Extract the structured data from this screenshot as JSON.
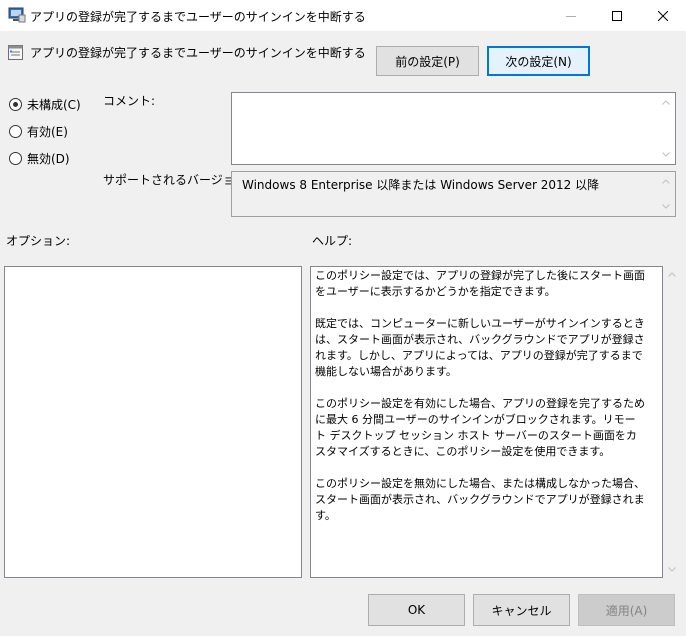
{
  "window": {
    "title": "アプリの登録が完了するまでユーザーのサインインを中断する",
    "controls": {
      "minimize_icon": "minimize-icon",
      "maximize_icon": "maximize-icon",
      "close_icon": "close-icon"
    }
  },
  "header": {
    "policy_name": "アプリの登録が完了するまでユーザーのサインインを中断する",
    "prev_label": "前の設定(P)",
    "next_label": "次の設定(N)"
  },
  "state": {
    "options": [
      {
        "label": "未構成(C)",
        "checked": true
      },
      {
        "label": "有効(E)",
        "checked": false
      },
      {
        "label": "無効(D)",
        "checked": false
      }
    ]
  },
  "comment": {
    "label": "コメント:",
    "value": ""
  },
  "supported": {
    "label": "サポートされるバージョン:",
    "value": "Windows 8 Enterprise 以降または Windows Server 2012 以降"
  },
  "options_label": "オプション:",
  "help": {
    "label": "ヘルプ:",
    "text": "このポリシー設定では、アプリの登録が完了した後にスタート画面をユーザーに表示するかどうかを指定できます。\n\n既定では、コンピューターに新しいユーザーがサインインするときは、スタート画面が表示され、バックグラウンドでアプリが登録されます。しかし、アプリによっては、アプリの登録が完了するまで機能しない場合があります。\n\nこのポリシー設定を有効にした場合、アプリの登録を完了するために最大 6 分間ユーザーのサインインがブロックされます。リモート デスクトップ セッション ホスト サーバーのスタート画面をカスタマイズするときに、このポリシー設定を使用できます。\n\nこのポリシー設定を無効にした場合、または構成しなかった場合、スタート画面が表示され、バックグラウンドでアプリが登録されます。"
  },
  "footer": {
    "ok_label": "OK",
    "cancel_label": "キャンセル",
    "apply_label": "適用(A)"
  },
  "colors": {
    "accent": "#0078d7",
    "background": "#f0f0f0"
  }
}
